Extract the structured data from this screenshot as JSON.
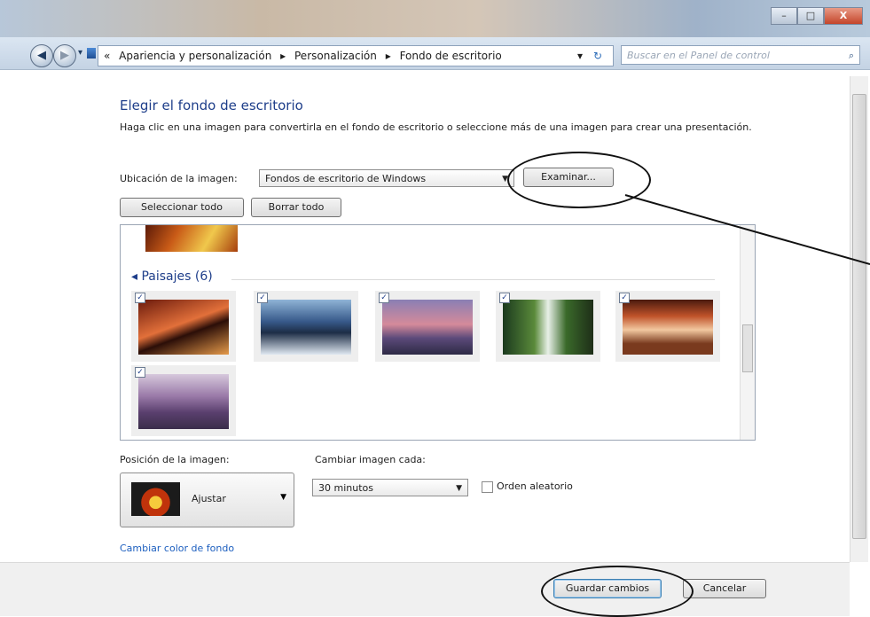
{
  "window": {
    "min": "–",
    "max": "□",
    "close": "X"
  },
  "nav": {
    "back": "◀",
    "forward": "▶",
    "dropdown": "▾",
    "history_prefix": "«",
    "breadcrumb": [
      "Apariencia y personalización",
      "▸",
      "Personalización",
      "▸",
      "Fondo de escritorio"
    ],
    "addr_arrow": "▾",
    "refresh": "↻",
    "search_placeholder": "Buscar en el Panel de control",
    "search_icon": "⌕"
  },
  "content": {
    "title": "Elegir el fondo de escritorio",
    "description": "Haga clic en una imagen para convertirla en el fondo de escritorio o seleccione más de una imagen para crear una presentación.",
    "location_label": "Ubicación de la imagen:",
    "location_value": "Fondos de escritorio de Windows",
    "browse": "Examinar...",
    "select_all": "Seleccionar todo",
    "clear_all": "Borrar todo",
    "group": {
      "bullet": "◂",
      "label": "Paisajes (6)"
    },
    "check": "✓",
    "position_label": "Posición de la imagen:",
    "position_value": "Ajustar",
    "interval_label": "Cambiar imagen cada:",
    "interval_value": "30 minutos",
    "shuffle_label": "Orden aleatorio",
    "shuffle_checked": false,
    "change_color_link": "Cambiar color de fondo"
  },
  "footer": {
    "save": "Guardar cambios",
    "cancel": "Cancelar"
  },
  "icons": {
    "back": "back-arrow-icon",
    "forward": "forward-arrow-icon",
    "search": "search-icon",
    "folder": "control-panel-icon"
  }
}
